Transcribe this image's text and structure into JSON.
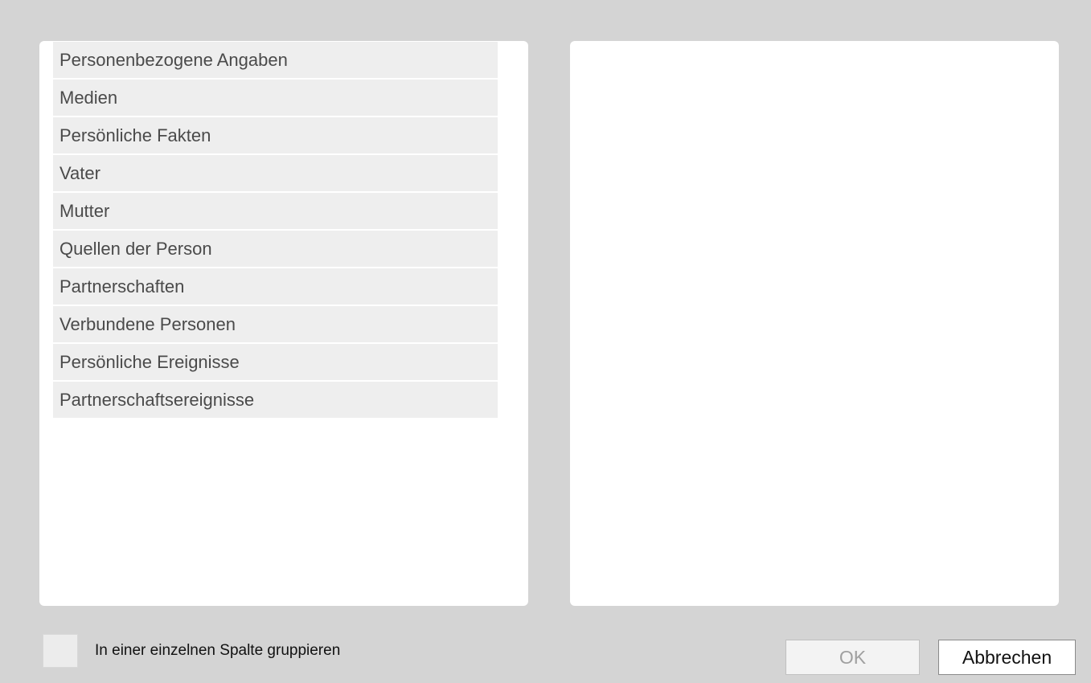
{
  "left_list": {
    "items": [
      {
        "label": "Personenbezogene Angaben"
      },
      {
        "label": "Medien"
      },
      {
        "label": "Persönliche Fakten"
      },
      {
        "label": "Vater"
      },
      {
        "label": "Mutter"
      },
      {
        "label": "Quellen der Person"
      },
      {
        "label": "Partnerschaften"
      },
      {
        "label": "Verbundene Personen"
      },
      {
        "label": "Persönliche Ereignisse"
      },
      {
        "label": "Partnerschaftsereignisse"
      }
    ]
  },
  "right_list": {
    "items": []
  },
  "options": {
    "group_single_column": {
      "label": "In einer einzelnen Spalte gruppieren",
      "checked": false
    }
  },
  "buttons": {
    "ok_label": "OK",
    "ok_enabled": false,
    "cancel_label": "Abbrechen"
  },
  "colors": {
    "background": "#d4d4d4",
    "panel": "#ffffff",
    "list_item": "#eeeeee",
    "list_text": "#4a4a4a",
    "disabled_text": "#a0a0a0"
  }
}
